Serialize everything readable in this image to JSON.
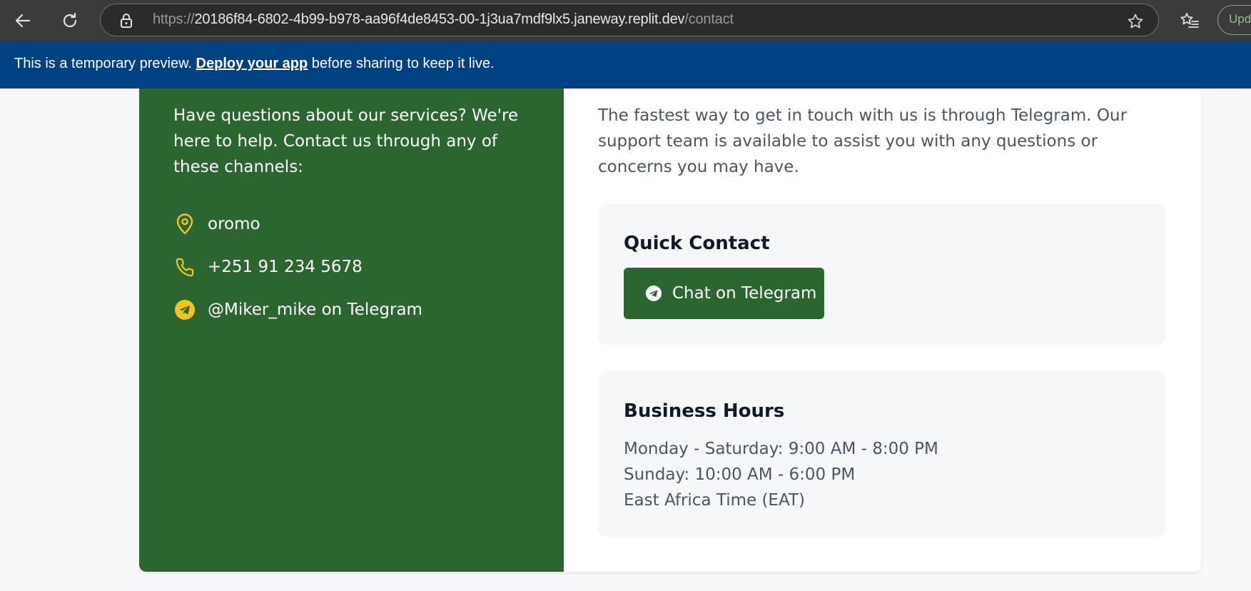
{
  "browser": {
    "url_scheme": "https://",
    "url_host": "20186f84-6802-4b99-b978-aa96f4de8453-00-1j3ua7mdf9lx5.janeway.replit.dev",
    "url_path": "/contact",
    "update_label": "Upd",
    "icons": [
      "back-icon",
      "reload-icon",
      "lock-icon",
      "star-icon",
      "favorites-icon"
    ]
  },
  "banner": {
    "prefix": "This is a temporary preview. ",
    "link": "Deploy your app",
    "suffix": " before sharing to keep it live."
  },
  "contact_info": {
    "intro": "Have questions about our services? We're here to help. Contact us through any of these channels:",
    "items": [
      {
        "icon": "map-pin-icon",
        "text": "oromo"
      },
      {
        "icon": "phone-icon",
        "text": "+251 91 234 5678"
      },
      {
        "icon": "telegram-icon",
        "text": "@Miker_mike on Telegram"
      }
    ]
  },
  "support": {
    "lead": "The fastest way to get in touch with us is through Telegram. Our support team is available to assist you with any questions or concerns you may have."
  },
  "quick_contact": {
    "title": "Quick Contact",
    "button_label": "Chat on Telegram"
  },
  "business_hours": {
    "title": "Business Hours",
    "lines": [
      "Monday - Saturday: 9:00 AM - 8:00 PM",
      "Sunday: 10:00 AM - 6:00 PM",
      "East Africa Time (EAT)"
    ]
  },
  "colors": {
    "brand_green": "#2b6630",
    "accent_yellow": "#f5c518",
    "banner_blue": "#004182"
  }
}
